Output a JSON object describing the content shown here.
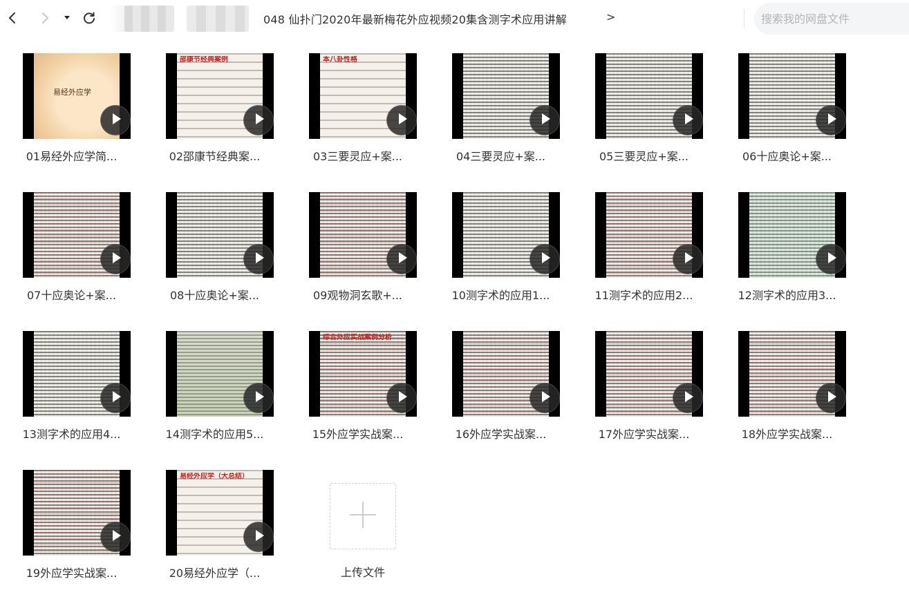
{
  "toolbar": {
    "back_icon": "chevron-left-icon",
    "forward_icon": "chevron-right-icon",
    "history_icon": "caret-down-icon",
    "refresh_icon": "refresh-icon"
  },
  "breadcrumb": {
    "folder_title": "048 仙扑门2020年最新梅花外应视频20集含测字术应用讲解",
    "arrow": ">"
  },
  "search": {
    "placeholder": "搜索我的网盘文件"
  },
  "files": [
    {
      "label": "01易经外应学简...",
      "thumb_text": "易经外应学",
      "style": "scroll"
    },
    {
      "label": "02邵康节经典案...",
      "thumb_text": "邵康节经典案例",
      "style": "slide"
    },
    {
      "label": "03三要灵应+案...",
      "thumb_text": "本八卦性格",
      "style": "slide"
    },
    {
      "label": "04三要灵应+案...",
      "thumb_text": "",
      "style": "doc"
    },
    {
      "label": "05三要灵应+案...",
      "thumb_text": "",
      "style": "doc"
    },
    {
      "label": "06十应奥论+案...",
      "thumb_text": "",
      "style": "doc"
    },
    {
      "label": "07十应奥论+案...",
      "thumb_text": "",
      "style": "doc-red"
    },
    {
      "label": "08十应奥论+案...",
      "thumb_text": "",
      "style": "doc"
    },
    {
      "label": "09观物洞玄歌+...",
      "thumb_text": "",
      "style": "doc-red"
    },
    {
      "label": "10测字术的应用1...",
      "thumb_text": "",
      "style": "doc"
    },
    {
      "label": "11测字术的应用2...",
      "thumb_text": "",
      "style": "doc-red"
    },
    {
      "label": "12测字术的应用3...",
      "thumb_text": "",
      "style": "green"
    },
    {
      "label": "13测字术的应用4...",
      "thumb_text": "",
      "style": "doc"
    },
    {
      "label": "14测字术的应用5...",
      "thumb_text": "",
      "style": "landscape"
    },
    {
      "label": "15外应学实战案...",
      "thumb_text": "综合外应实战案例分析",
      "style": "doc-red"
    },
    {
      "label": "16外应学实战案...",
      "thumb_text": "",
      "style": "doc-red"
    },
    {
      "label": "17外应学实战案...",
      "thumb_text": "",
      "style": "doc-red"
    },
    {
      "label": "18外应学实战案...",
      "thumb_text": "",
      "style": "doc-red"
    },
    {
      "label": "19外应学实战案...",
      "thumb_text": "",
      "style": "doc-red"
    },
    {
      "label": "20易经外应学（...",
      "thumb_text": "易经外应学（大总结）",
      "style": "slide"
    }
  ],
  "upload": {
    "label": "上传文件",
    "icon": "plus-icon"
  },
  "colors": {
    "text": "#333333",
    "placeholder": "#b5b5b5",
    "search_bg": "#f4f5f7",
    "play_bg": "#2a2a2a",
    "dashed_border": "#cfd4dc"
  }
}
